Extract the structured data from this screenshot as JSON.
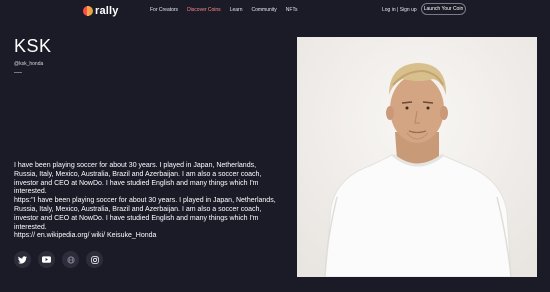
{
  "nav": {
    "logo_text": "rally",
    "links": [
      "For Creators",
      "Discover Coins",
      "Learn",
      "Community",
      "NFTs"
    ],
    "login": "Log in | Sign up",
    "launch": "Launch Your Coin"
  },
  "profile": {
    "name": "KSK",
    "handle": "@ksk_honda",
    "bio": [
      "I have been playing soccer for about 30 years. I played in Japan, Netherlands, Russia, Italy, Mexico, Australia, Brazil and Azerbaijan. I am also a soccer coach, investor and CEO at NowDo. I have studied English and many things which I'm interested.",
      "https:\"I have been playing soccer for about 30 years. I played in Japan, Netherlands, Russia, Italy, Mexico, Australia, Brazil and Azerbaijan. I am also a soccer coach, investor and CEO at NowDo. I have studied English and many things which I'm interested.",
      "https:// en.wikipedia.org/ wiki/ Keisuke_Honda"
    ]
  },
  "socials": [
    "twitter-icon",
    "youtube-icon",
    "globe-icon",
    "instagram-icon"
  ],
  "colors": {
    "background": "#1a1b27",
    "accent": "#ff8a8f",
    "photo_bg": "#f4f1ee"
  }
}
